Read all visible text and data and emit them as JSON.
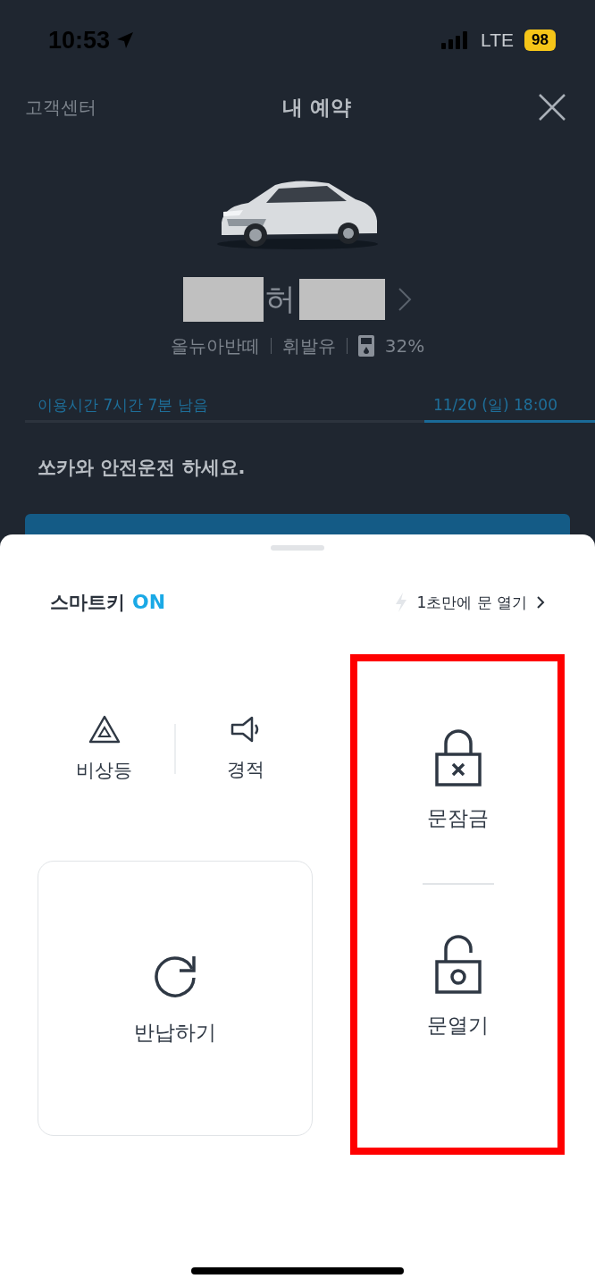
{
  "status_bar": {
    "time": "10:53",
    "network": "LTE",
    "battery": "98"
  },
  "header": {
    "left_link": "고객센터",
    "title": "내 예약"
  },
  "car": {
    "kind": "picture",
    "plate": "허",
    "model": "올뉴아반떼",
    "fuel_type": "휘발유",
    "fuel_level_text": "32%"
  },
  "usage": {
    "remaining": "이용시간 7시간 7분 남음",
    "end_time": "11/20 (일) 18:00",
    "level": 0.3
  },
  "message": "쏘카와 안전운전 하세요.",
  "sheet": {
    "smart_key": {
      "label": "스마트키",
      "status": "ON",
      "on": true
    },
    "quick_open": "1초만에 문 열기",
    "controls": [
      {
        "kind": "hazard",
        "label": "비상등"
      },
      {
        "kind": "horn",
        "label": "경적"
      },
      {
        "kind": "return",
        "label": "반납하기"
      },
      {
        "kind": "lock",
        "label": "문잠금"
      },
      {
        "kind": "unlock",
        "label": "문열기"
      }
    ]
  },
  "highlight": {
    "shown": true
  }
}
